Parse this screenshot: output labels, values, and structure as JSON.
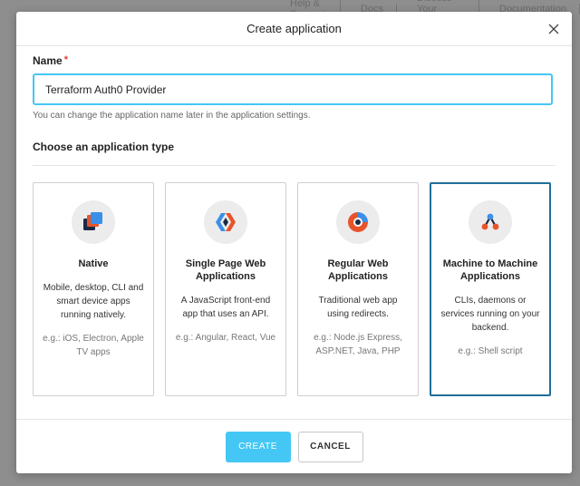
{
  "background": {
    "nav_items": [
      "Help & Support",
      "Docs",
      "Discuss Your Needs",
      "Documentation"
    ]
  },
  "modal": {
    "title": "Create application",
    "close_icon": "close-icon"
  },
  "name_field": {
    "label": "Name",
    "required_marker": "*",
    "value": "Terraform Auth0 Provider",
    "hint": "You can change the application name later in the application settings."
  },
  "app_type": {
    "section_title": "Choose an application type",
    "cards": [
      {
        "icon": "native-icon",
        "title": "Native",
        "description": "Mobile, desktop, CLI and smart device apps running natively.",
        "example": "e.g.: iOS, Electron, Apple TV apps",
        "selected": false
      },
      {
        "icon": "single-page-app-icon",
        "title": "Single Page Web Applications",
        "description": "A JavaScript front-end app that uses an API.",
        "example": "e.g.: Angular, React, Vue",
        "selected": false
      },
      {
        "icon": "regular-web-app-icon",
        "title": "Regular Web Applications",
        "description": "Traditional web app using redirects.",
        "example": "e.g.: Node.js Express, ASP.NET, Java, PHP",
        "selected": false
      },
      {
        "icon": "machine-to-machine-icon",
        "title": "Machine to Machine Applications",
        "description": "CLIs, daemons or services running on your backend.",
        "example": "e.g.: Shell script",
        "selected": true
      }
    ]
  },
  "footer": {
    "create_label": "CREATE",
    "cancel_label": "CANCEL"
  },
  "colors": {
    "accent": "#44c7f4",
    "selected_border": "#1f6f9a",
    "required": "#e53935"
  }
}
